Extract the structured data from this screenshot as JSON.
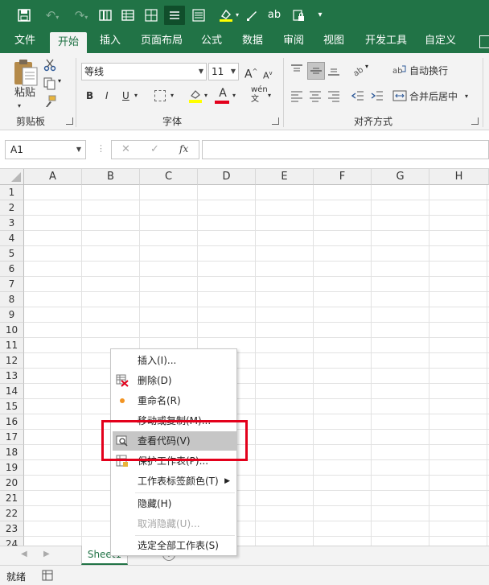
{
  "qat": {
    "customize": "▾"
  },
  "tabs": [
    "文件",
    "开始",
    "插入",
    "页面布局",
    "公式",
    "数据",
    "审阅",
    "视图",
    "开发工具",
    "自定义"
  ],
  "active_tab": "开始",
  "ribbon": {
    "clipboard": {
      "paste": "粘贴",
      "label": "剪贴板"
    },
    "font": {
      "name": "等线",
      "size": "11",
      "label": "字体",
      "bold": "B",
      "italic": "I",
      "underline": "U",
      "grow": "A",
      "shrink": "A",
      "phonetic": "wén"
    },
    "alignment": {
      "wrap": "自动换行",
      "merge": "合并后居中",
      "label": "对齐方式"
    }
  },
  "formula_bar": {
    "name_box": "A1",
    "cancel": "✕",
    "enter": "✓",
    "fx": "fx",
    "value": ""
  },
  "columns": [
    "A",
    "B",
    "C",
    "D",
    "E",
    "F",
    "G",
    "H"
  ],
  "rows": [
    "1",
    "2",
    "3",
    "4",
    "5",
    "6",
    "7",
    "8",
    "9",
    "10",
    "11",
    "12",
    "13",
    "14",
    "15",
    "16",
    "17",
    "18",
    "19",
    "20",
    "21",
    "22",
    "23",
    "24"
  ],
  "context_menu": [
    {
      "label": "插入(I)...",
      "enabled": true
    },
    {
      "label": "删除(D)",
      "enabled": true
    },
    {
      "label": "重命名(R)",
      "enabled": true
    },
    {
      "label": "移动或复制(M)...",
      "enabled": true
    },
    {
      "label": "查看代码(V)",
      "enabled": true,
      "hover": true
    },
    {
      "label": "保护工作表(P)...",
      "enabled": true
    },
    {
      "label": "工作表标签颜色(T)",
      "enabled": true,
      "submenu": true
    },
    {
      "label": "隐藏(H)",
      "enabled": true
    },
    {
      "label": "取消隐藏(U)...",
      "enabled": false
    },
    {
      "label": "选定全部工作表(S)",
      "enabled": true
    }
  ],
  "sheet_tab": "Sheet1",
  "status": {
    "ready": "就绪"
  },
  "colors": {
    "accent": "#217346",
    "highlight": "#e3001b"
  }
}
